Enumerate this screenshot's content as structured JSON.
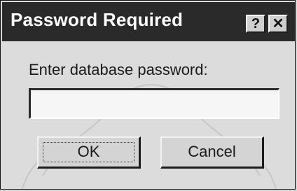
{
  "dialog": {
    "title": "Password Required",
    "help_button": "?",
    "close_button": "✕",
    "prompt": "Enter database password:",
    "password": {
      "value": "",
      "placeholder": ""
    },
    "ok_label": "OK",
    "cancel_label": "Cancel"
  },
  "colors": {
    "titlebar": "#2a2a2a",
    "dialog_face": "#dcdcdc",
    "field_bg": "#f6f6f6"
  }
}
